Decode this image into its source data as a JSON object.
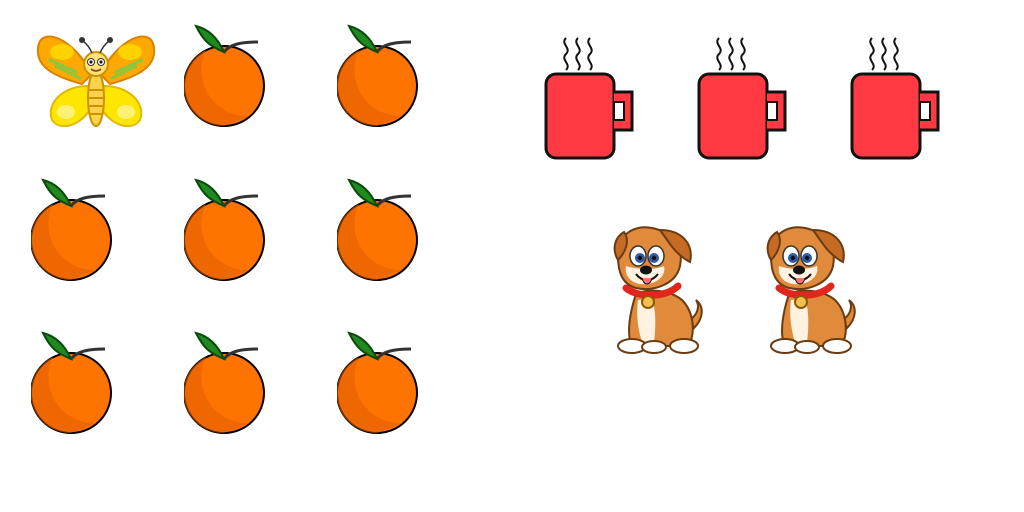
{
  "scene": {
    "left_group": {
      "items": [
        {
          "kind": "butterfly",
          "icon": "butterfly-icon"
        },
        {
          "kind": "orange",
          "icon": "orange-icon"
        },
        {
          "kind": "orange",
          "icon": "orange-icon"
        },
        {
          "kind": "orange",
          "icon": "orange-icon"
        },
        {
          "kind": "orange",
          "icon": "orange-icon"
        },
        {
          "kind": "orange",
          "icon": "orange-icon"
        },
        {
          "kind": "orange",
          "icon": "orange-icon"
        },
        {
          "kind": "orange",
          "icon": "orange-icon"
        },
        {
          "kind": "orange",
          "icon": "orange-icon"
        }
      ],
      "counts": {
        "butterfly": 1,
        "orange": 8
      }
    },
    "right_group": {
      "items": [
        {
          "kind": "mug",
          "icon": "steaming-mug-icon"
        },
        {
          "kind": "mug",
          "icon": "steaming-mug-icon"
        },
        {
          "kind": "mug",
          "icon": "steaming-mug-icon"
        },
        {
          "kind": "puppy",
          "icon": "puppy-icon"
        },
        {
          "kind": "puppy",
          "icon": "puppy-icon"
        }
      ],
      "counts": {
        "mug": 3,
        "puppy": 2
      }
    },
    "colors": {
      "background": "#ffffff",
      "orange_fill": "#ff7400",
      "orange_shade": "#e15c00",
      "leaf": "#1f8a1f",
      "mug_fill": "#ff3a43",
      "butterfly_wing": "#ffa800",
      "butterfly_inner": "#ffe600",
      "puppy_fur": "#e08a3c",
      "collar": "#e1261c"
    }
  }
}
